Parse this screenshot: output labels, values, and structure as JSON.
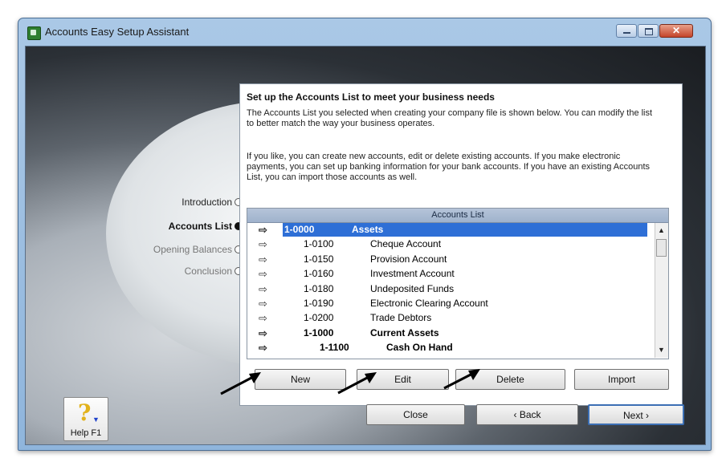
{
  "window": {
    "title": "Accounts Easy Setup Assistant",
    "close_glyph": "✕"
  },
  "steps": [
    {
      "label": "Introduction",
      "state": "done"
    },
    {
      "label": "Accounts List",
      "state": "current"
    },
    {
      "label": "Opening Balances",
      "state": "pending"
    },
    {
      "label": "Conclusion",
      "state": "pending"
    }
  ],
  "panel": {
    "heading": "Set up the Accounts List to meet your business needs",
    "paragraph1": "The Accounts List you selected when creating your company file is shown below. You can modify the list to better match the way your business operates.",
    "paragraph2": "If you like, you can create new accounts, edit or delete existing accounts.  If you make electronic payments, you can set up banking information for your bank accounts. If you have an existing Accounts List, you can import those accounts as well."
  },
  "accounts_list": {
    "title": "Accounts List",
    "row_icon": "arrow-right-icon",
    "rows": [
      {
        "number": "1-0000",
        "name": "Assets",
        "level": 0,
        "bold": true,
        "selected": true
      },
      {
        "number": "1-0100",
        "name": "Cheque Account",
        "level": 1,
        "bold": false,
        "selected": false
      },
      {
        "number": "1-0150",
        "name": "Provision Account",
        "level": 1,
        "bold": false,
        "selected": false
      },
      {
        "number": "1-0160",
        "name": "Investment Account",
        "level": 1,
        "bold": false,
        "selected": false
      },
      {
        "number": "1-0180",
        "name": "Undeposited Funds",
        "level": 1,
        "bold": false,
        "selected": false
      },
      {
        "number": "1-0190",
        "name": "Electronic Clearing Account",
        "level": 1,
        "bold": false,
        "selected": false
      },
      {
        "number": "1-0200",
        "name": "Trade Debtors",
        "level": 1,
        "bold": false,
        "selected": false
      },
      {
        "number": "1-1000",
        "name": "Current Assets",
        "level": 1,
        "bold": true,
        "selected": false
      },
      {
        "number": "1-1100",
        "name": "Cash On Hand",
        "level": 2,
        "bold": true,
        "selected": false
      }
    ]
  },
  "buttons": {
    "new": "New",
    "edit": "Edit",
    "delete": "Delete",
    "import": "Import",
    "close": "Close",
    "back": "‹ Back",
    "next": "Next ›",
    "help": "Help F1"
  },
  "colors": {
    "selection": "#2e6fd6",
    "annotation_arrow": "#000000",
    "window_frame": "#aac8e6",
    "close_button": "#c4442a"
  }
}
